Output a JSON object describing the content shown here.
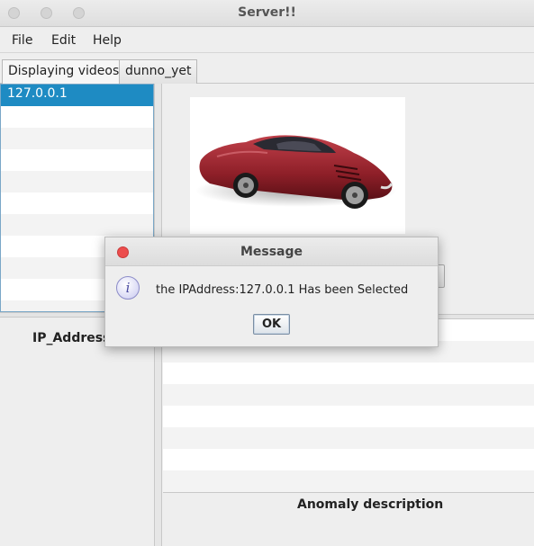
{
  "window": {
    "title": "Server!!"
  },
  "menubar": {
    "items": [
      "File",
      "Edit",
      "Help"
    ]
  },
  "tabs": [
    {
      "label": "Displaying videos",
      "active": true
    },
    {
      "label": "dunno_yet",
      "active": false
    }
  ],
  "ip_list": {
    "items": [
      "127.0.0.1"
    ],
    "selected": "127.0.0.1"
  },
  "left_bottom": {
    "header": "IP_Address"
  },
  "right_bottom": {
    "footer_label": "Anomaly description"
  },
  "video_panel": {
    "content": "red sports car image"
  },
  "dialog": {
    "title": "Message",
    "message": "the IPAddress:127.0.0.1 Has been Selected",
    "ok_label": "OK",
    "icon": "info-icon"
  },
  "colors": {
    "selection": "#1e8bc3",
    "close_button": "#ec4d4d",
    "list_border": "#7aa7c7"
  }
}
